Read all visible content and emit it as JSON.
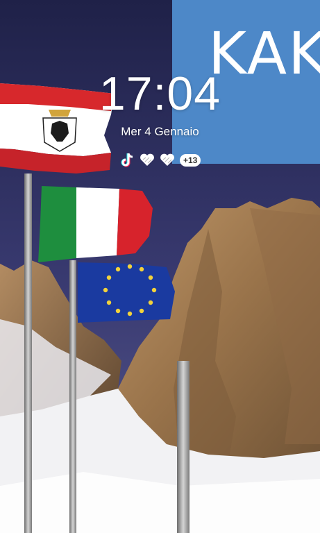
{
  "lockscreen": {
    "time": "17:04",
    "date": "Mer 4 Gennaio",
    "notifications": {
      "icons": [
        "tiktok-icon",
        "heart-icon",
        "heart-icon"
      ],
      "more_count": "+13"
    }
  },
  "wallpaper": {
    "overlay_text": "KAK",
    "colors": {
      "sky": "#2b2d57",
      "overlay_blue": "#4d88c8",
      "rock": "#a88357",
      "snow": "#f2f2f4"
    }
  }
}
